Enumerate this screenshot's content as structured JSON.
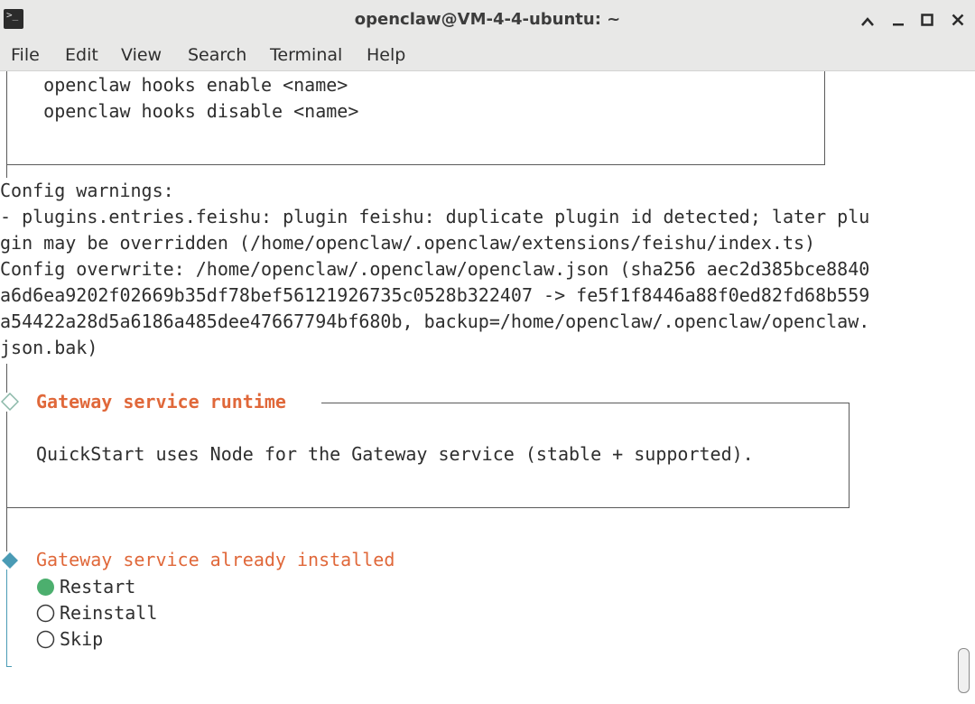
{
  "window": {
    "title": "openclaw@VM-4-4-ubuntu: ~",
    "icon": "terminal-icon",
    "controls": {
      "collapse": "^",
      "minimize": "_",
      "maximize": "□",
      "close": "✕"
    }
  },
  "menu": [
    "File",
    "Edit",
    "View",
    "Search",
    "Terminal",
    "Help"
  ],
  "terminal": {
    "hooks_box": [
      "    openclaw hooks enable <name>",
      "    openclaw hooks disable <name>"
    ],
    "config_lines": [
      "Config warnings:",
      "- plugins.entries.feishu: plugin feishu: duplicate plugin id detected; later plu",
      "gin may be overridden (/home/openclaw/.openclaw/extensions/feishu/index.ts)",
      "Config overwrite: /home/openclaw/.openclaw/openclaw.json (sha256 aec2d385bce8840",
      "a6d6ea9202f02669b35df78bef56121926735c0528b322407 -> fe5f1f8446a88f0ed82fd68b559",
      "a54422a28d5a6186a485dee47667794bf680b, backup=/home/openclaw/.openclaw/openclaw.",
      "json.bak)"
    ],
    "runtime": {
      "title": "Gateway service runtime",
      "text": "QuickStart uses Node for the Gateway service (stable + supported)."
    },
    "prompt": {
      "title": "Gateway service already installed",
      "options": [
        "Restart",
        "Reinstall",
        "Skip"
      ],
      "selected": "Restart"
    }
  },
  "colors": {
    "accent": "#e0683a",
    "diamond": "#4a9bb5",
    "selected_radio": "#4caf6e"
  }
}
